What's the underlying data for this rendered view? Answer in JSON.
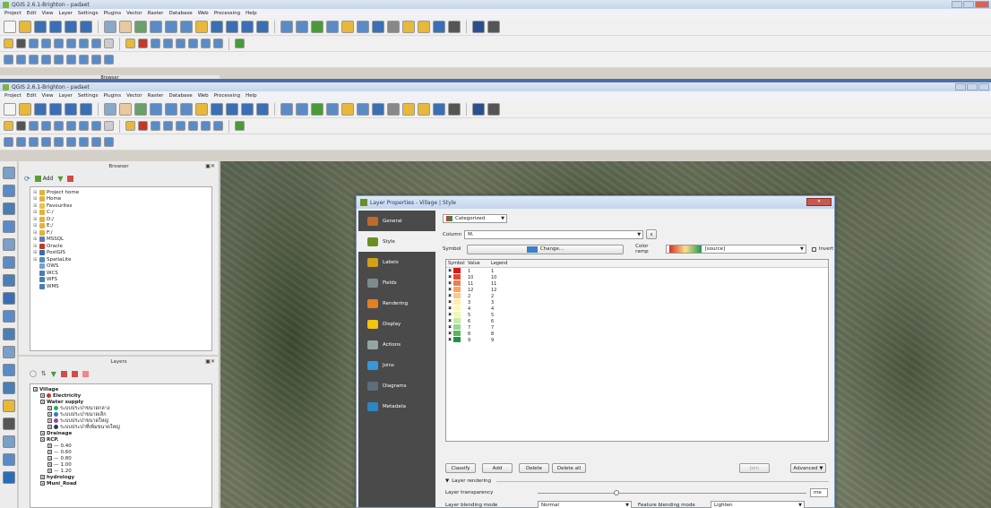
{
  "window_back": {
    "title": "QGIS 2.6.1-Brighton - padaet",
    "menu": [
      "Project",
      "Edit",
      "View",
      "Layer",
      "Settings",
      "Plugins",
      "Vector",
      "Raster",
      "Database",
      "Web",
      "Processing",
      "Help"
    ],
    "browser_stub": "Browser"
  },
  "window_front": {
    "title": "QGIS 2.6.1-Brighton - padaet",
    "menu": [
      "Project",
      "Edit",
      "View",
      "Layer",
      "Settings",
      "Plugins",
      "Vector",
      "Raster",
      "Database",
      "Web",
      "Processing",
      "Help"
    ]
  },
  "browser": {
    "title": "Browser",
    "add_label": "Add",
    "items": [
      {
        "label": "Project home",
        "icon": "folder-icon",
        "color": "#e2b33c"
      },
      {
        "label": "Home",
        "icon": "folder-icon",
        "color": "#e2b33c"
      },
      {
        "label": "Favourites",
        "icon": "star-icon",
        "color": "#e8c24a"
      },
      {
        "label": "C:/",
        "icon": "drive-icon",
        "color": "#e2b33c"
      },
      {
        "label": "D:/",
        "icon": "drive-icon",
        "color": "#e2b33c"
      },
      {
        "label": "E:/",
        "icon": "drive-icon",
        "color": "#e2b33c"
      },
      {
        "label": "F:/",
        "icon": "drive-icon",
        "color": "#e2b33c"
      },
      {
        "label": "MSSQL",
        "icon": "database-icon",
        "color": "#5a7bb5"
      },
      {
        "label": "Oracle",
        "icon": "database-icon",
        "color": "#c0392b"
      },
      {
        "label": "PostGIS",
        "icon": "database-icon",
        "color": "#3b6ea5"
      },
      {
        "label": "SpatiaLite",
        "icon": "database-icon",
        "color": "#4a8fc4"
      },
      {
        "label": "OWS",
        "icon": "globe-icon",
        "color": "#7a9fc9"
      },
      {
        "label": "WCS",
        "icon": "globe-icon",
        "color": "#4a7fb5"
      },
      {
        "label": "WFS",
        "icon": "globe-icon",
        "color": "#4a7fb5"
      },
      {
        "label": "WMS",
        "icon": "globe-icon",
        "color": "#4a7fb5"
      }
    ]
  },
  "layers": {
    "title": "Layers",
    "items": [
      {
        "label": "Village",
        "bold": true,
        "indent": 0
      },
      {
        "label": "Electricity",
        "bold": true,
        "indent": 1,
        "dot": "#c0392b"
      },
      {
        "label": "Water supply",
        "bold": true,
        "indent": 1
      },
      {
        "label": "ระบบประปาขนาดกลาง",
        "indent": 2,
        "dot": "#27ae60"
      },
      {
        "label": "ระบบประปาขนาดเล็ก",
        "indent": 2,
        "dot": "#2980b9"
      },
      {
        "label": "ระบบประปาขนาดใหญ่",
        "indent": 2,
        "dot": "#8e44ad"
      },
      {
        "label": "ระบบประปาที่เพิ่มขนาดใหญ่",
        "indent": 2,
        "dot": "#2c3e50"
      },
      {
        "label": "Drainage",
        "bold": true,
        "indent": 1
      },
      {
        "label": "RCP.",
        "bold": true,
        "indent": 1
      },
      {
        "label": "0.40",
        "indent": 2
      },
      {
        "label": "0.60",
        "indent": 2
      },
      {
        "label": "0.80",
        "indent": 2
      },
      {
        "label": "1.00",
        "indent": 2
      },
      {
        "label": "1.20",
        "indent": 2
      },
      {
        "label": "hydrology",
        "bold": true,
        "indent": 1
      },
      {
        "label": "Muni_Road",
        "bold": true,
        "indent": 1
      }
    ]
  },
  "dialog": {
    "title": "Layer Properties - Village | Style",
    "close_label": "",
    "sidebar": [
      {
        "label": "General",
        "color": "#c0692b"
      },
      {
        "label": "Style",
        "color": "#6b8e23",
        "active": true
      },
      {
        "label": "Labels",
        "color": "#d4a017"
      },
      {
        "label": "Fields",
        "color": "#7f8c8d"
      },
      {
        "label": "Rendering",
        "color": "#e67e22"
      },
      {
        "label": "Display",
        "color": "#f1c40f"
      },
      {
        "label": "Actions",
        "color": "#95a5a6"
      },
      {
        "label": "Joins",
        "color": "#3498db"
      },
      {
        "label": "Diagrams",
        "color": "#5d6d7e"
      },
      {
        "label": "Metadata",
        "color": "#2e86c1"
      }
    ],
    "renderer": "Categorized",
    "column_label": "Column",
    "column_value": "M.",
    "symbol_label": "Symbol",
    "change_label": "Change...",
    "color_ramp_label": "Color ramp",
    "color_ramp_value": "[source]",
    "invert_label": "Invert",
    "table_headers": {
      "symbol": "Symbol",
      "value": "Value",
      "legend": "Legend"
    },
    "rows": [
      {
        "value": "1",
        "legend": "1",
        "color": "#d7191c"
      },
      {
        "value": "10",
        "legend": "10",
        "color": "#e34a33"
      },
      {
        "value": "11",
        "legend": "11",
        "color": "#f07c4a"
      },
      {
        "value": "12",
        "legend": "12",
        "color": "#f9a65a"
      },
      {
        "value": "2",
        "legend": "2",
        "color": "#fec980"
      },
      {
        "value": "3",
        "legend": "3",
        "color": "#ffedaa"
      },
      {
        "value": "4",
        "legend": "4",
        "color": "#fff7bc"
      },
      {
        "value": "5",
        "legend": "5",
        "color": "#edf8b1"
      },
      {
        "value": "6",
        "legend": "6",
        "color": "#c7e9a9"
      },
      {
        "value": "7",
        "legend": "7",
        "color": "#99d594"
      },
      {
        "value": "8",
        "legend": "8",
        "color": "#5ab460"
      },
      {
        "value": "9",
        "legend": "9",
        "color": "#1a9641"
      }
    ],
    "buttons": {
      "classify": "Classify",
      "add": "Add",
      "delete": "Delete",
      "delete_all": "Delete all",
      "join": "Join",
      "advanced": "Advanced"
    },
    "layer_rendering_label": "Layer rendering",
    "transparency_label": "Layer transparency",
    "transparency_value": "me",
    "blending_label": "Layer blending mode",
    "blending_value": "Normal",
    "feature_blending_label": "Feature blending mode",
    "feature_blending_value": "Lighten"
  }
}
